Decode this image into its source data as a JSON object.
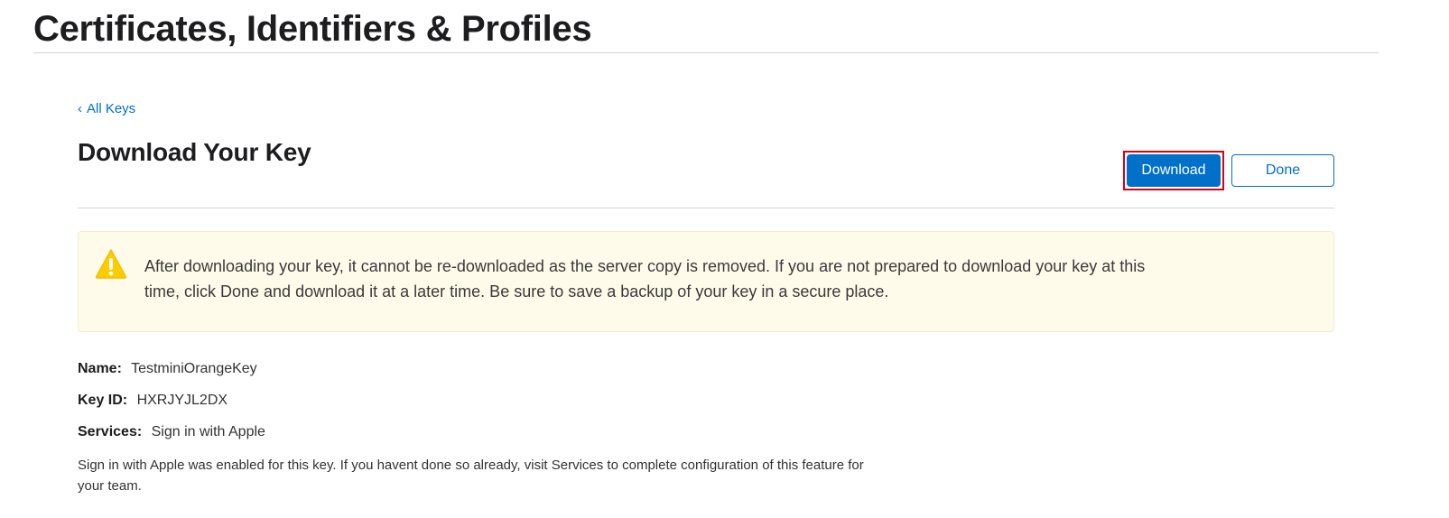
{
  "header": {
    "title": "Certificates, Identifiers & Profiles"
  },
  "nav": {
    "back_chevron": "‹",
    "back_label": "All Keys"
  },
  "key_page": {
    "title": "Download Your Key",
    "download_label": "Download",
    "done_label": "Done"
  },
  "warning": {
    "icon": "warning-triangle-icon",
    "text": "After downloading your key, it cannot be re-downloaded as the server copy is removed. If you are not prepared to download your key at this time, click Done and download it at a later time. Be sure to save a backup of your key in a secure place."
  },
  "details": {
    "name_label": "Name:",
    "name_value": "TestminiOrangeKey",
    "key_id_label": "Key ID:",
    "key_id_value": "HXRJYJL2DX",
    "services_label": "Services:",
    "services_value": "Sign in with Apple",
    "note": "Sign in with Apple was enabled for this key. If you havent done so already, visit Services to complete configuration of this feature for your team."
  },
  "colors": {
    "accent": "#0070c9",
    "warning_bg": "#fefbea",
    "warning_icon": "#ffcc00",
    "highlight_outline": "#d60017"
  }
}
